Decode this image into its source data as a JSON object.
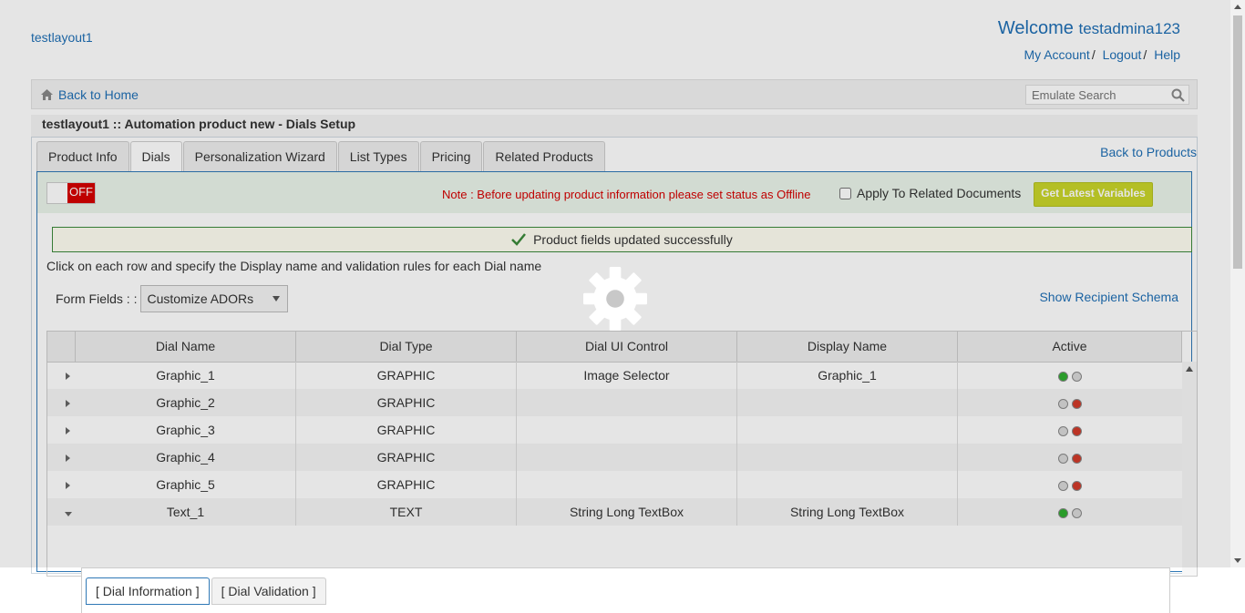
{
  "header": {
    "brand": "testlayout1",
    "welcome_label": "Welcome",
    "username": "testadmina123",
    "links": [
      "My Account",
      "Logout",
      "Help"
    ],
    "separator": "/"
  },
  "nav": {
    "home_label": "Back to Home",
    "search_placeholder": "Emulate Search"
  },
  "page_title": "testlayout1 :: Automation product new - Dials Setup",
  "tabs": [
    "Product Info",
    "Dials",
    "Personalization Wizard",
    "List Types",
    "Pricing",
    "Related Products"
  ],
  "active_tab": "Dials",
  "back_to_products": "Back to Products",
  "status": {
    "toggle_label": "OFF",
    "note": "Note : Before updating product information please set status as Offline",
    "apply_label": "Apply To Related Documents",
    "get_latest_label": "Get Latest Variables"
  },
  "success_message": "Product fields updated successfully",
  "instruction": "Click on each row and specify the Display name and validation rules for each Dial name",
  "form_fields": {
    "label": "Form Fields : :",
    "selected": "Customize ADORs"
  },
  "show_schema": "Show Recipient Schema",
  "table": {
    "columns": [
      "Dial Name",
      "Dial Type",
      "Dial UI Control",
      "Display Name",
      "Active"
    ],
    "rows": [
      {
        "name": "Graphic_1",
        "type": "GRAPHIC",
        "control": "Image Selector",
        "display": "Graphic_1",
        "active": true,
        "expanded": false
      },
      {
        "name": "Graphic_2",
        "type": "GRAPHIC",
        "control": "",
        "display": "",
        "active": false,
        "expanded": false
      },
      {
        "name": "Graphic_3",
        "type": "GRAPHIC",
        "control": "",
        "display": "",
        "active": false,
        "expanded": false
      },
      {
        "name": "Graphic_4",
        "type": "GRAPHIC",
        "control": "",
        "display": "",
        "active": false,
        "expanded": false
      },
      {
        "name": "Graphic_5",
        "type": "GRAPHIC",
        "control": "",
        "display": "",
        "active": false,
        "expanded": false
      },
      {
        "name": "Text_1",
        "type": "TEXT",
        "control": "String Long TextBox",
        "display": "String Long TextBox",
        "active": true,
        "expanded": true
      }
    ]
  },
  "subtabs": [
    "[ Dial Information ]",
    "[ Dial Validation ]"
  ],
  "colors": {
    "active_green": "#2fae2f",
    "inactive_red": "#d23a2a",
    "dot_off": "#d8d8d8"
  }
}
